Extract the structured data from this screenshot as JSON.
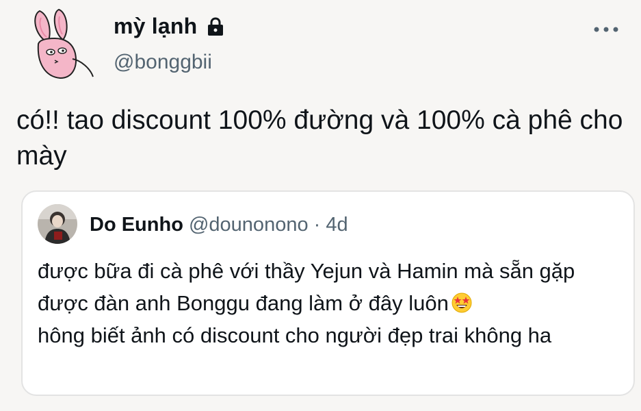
{
  "author": {
    "display_name": "mỳ lạnh",
    "handle": "@bonggbii",
    "avatar": "pink-rabbit-avatar",
    "protected_icon": "lock-icon"
  },
  "more_icon": "more-options-icon",
  "tweet": {
    "text": "có!! tao discount 100% đường và 100% cà phê cho mày"
  },
  "quoted_tweet": {
    "display_name": "Do Eunho",
    "handle": "@dounonono",
    "separator": "·",
    "time": "4d",
    "avatar": "profile-photo-avatar",
    "text_before_emoji": "được bữa đi cà phê với thầy Yejun và Hamin mà sẵn gặp được đàn anh Bonggu đang làm ở đây luôn",
    "emoji": "star-struck-emoji",
    "text_after_emoji": "hông biết ảnh có discount cho người đẹp trai không ha"
  },
  "colors": {
    "background": "#f7f6f4",
    "text": "#0f1419",
    "secondary_text": "#536471",
    "card_border": "#e3e3e3",
    "avatar_pink": "#f4b6c8"
  }
}
